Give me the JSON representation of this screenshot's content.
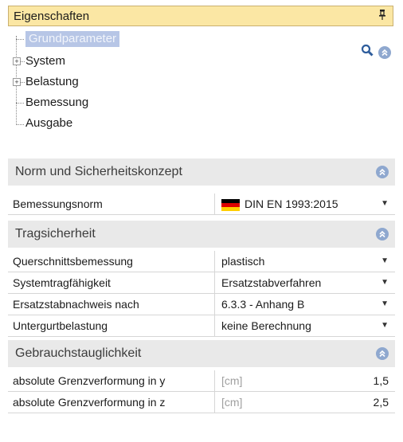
{
  "panel": {
    "title": "Eigenschaften",
    "pin_icon": "pin-icon"
  },
  "tree": {
    "items": [
      {
        "label": "Grundparameter",
        "selected": true,
        "expandable": false
      },
      {
        "label": "System",
        "selected": false,
        "expandable": true
      },
      {
        "label": "Belastung",
        "selected": false,
        "expandable": true
      },
      {
        "label": "Bemessung",
        "selected": false,
        "expandable": false
      },
      {
        "label": "Ausgabe",
        "selected": false,
        "expandable": false
      }
    ],
    "tools": {
      "search_icon": "search-icon",
      "collapse_icon": "collapse-all-icon"
    }
  },
  "sections": [
    {
      "title": "Norm und Sicherheitskonzept",
      "rows": [
        {
          "label": "Bemessungsnorm",
          "value": "DIN EN 1993:2015",
          "flag": "germany-flag-icon",
          "dropdown": true
        }
      ]
    },
    {
      "title": "Tragsicherheit",
      "rows": [
        {
          "label": "Querschnittsbemessung",
          "value": "plastisch",
          "dropdown": true
        },
        {
          "label": "Systemtragfähigkeit",
          "value": "Ersatzstabverfahren",
          "dropdown": true
        },
        {
          "label": "Ersatzstabnachweis nach",
          "value": "6.3.3 - Anhang B",
          "dropdown": true
        },
        {
          "label": "Untergurtbelastung",
          "value": "keine Berechnung",
          "dropdown": true
        }
      ]
    },
    {
      "title": "Gebrauchstauglichkeit",
      "rows": [
        {
          "label": "absolute Grenzverformung in y",
          "unit": "[cm]",
          "value": "1,5"
        },
        {
          "label": "absolute Grenzverformung in z",
          "unit": "[cm]",
          "value": "2,5"
        }
      ]
    }
  ],
  "colors": {
    "titlebar": "#fbe7a4",
    "selection": "#b7c6e6",
    "section_header": "#e9e9e9",
    "section_icon": "#8fa8cf"
  }
}
